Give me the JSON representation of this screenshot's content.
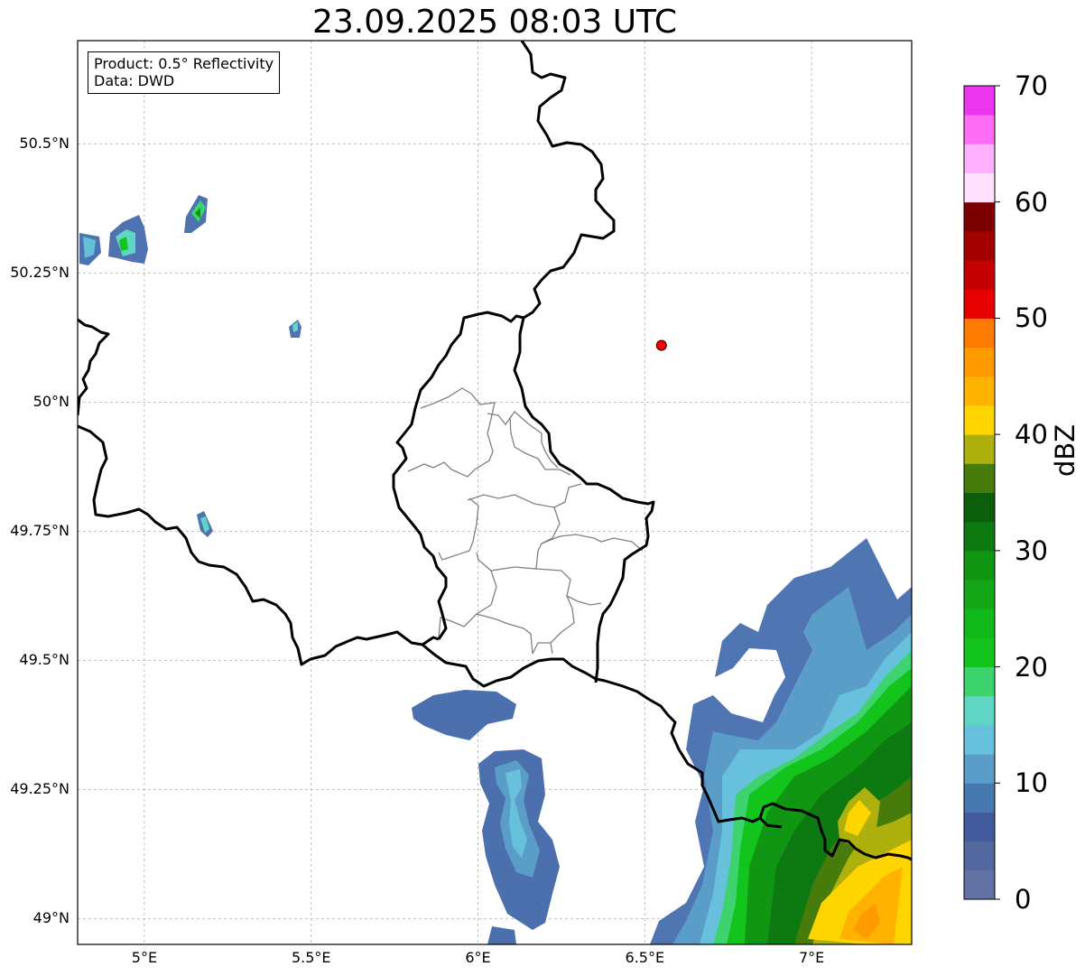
{
  "title": "23.09.2025 08:03 UTC",
  "info_box": {
    "line1": "Product: 0.5° Reflectivity",
    "line2": "Data: DWD"
  },
  "map": {
    "lon_ticks": [
      {
        "value": 5.0,
        "label": "5°E"
      },
      {
        "value": 5.5,
        "label": "5.5°E"
      },
      {
        "value": 6.0,
        "label": "6°E"
      },
      {
        "value": 6.5,
        "label": "6.5°E"
      },
      {
        "value": 7.0,
        "label": "7°E"
      }
    ],
    "lat_ticks": [
      {
        "value": 49.0,
        "label": "49°N"
      },
      {
        "value": 49.25,
        "label": "49.25°N"
      },
      {
        "value": 49.5,
        "label": "49.5°N"
      },
      {
        "value": 49.75,
        "label": "49.75°N"
      },
      {
        "value": 50.0,
        "label": "50°N"
      },
      {
        "value": 50.25,
        "label": "50.25°N"
      },
      {
        "value": 50.5,
        "label": "50.5°N"
      }
    ],
    "extent": {
      "lon_min": 4.8,
      "lon_max": 7.3,
      "lat_min": 48.95,
      "lat_max": 50.7
    },
    "marker": {
      "lon": 6.55,
      "lat": 50.11,
      "color": "#ff0000"
    },
    "gridlines": true
  },
  "colorbar": {
    "label": "dBZ",
    "ticks": [
      "0",
      "10",
      "20",
      "30",
      "40",
      "50",
      "60",
      "70"
    ],
    "min": 0,
    "max": 70,
    "step": 2.5,
    "colors": [
      "#6372a5",
      "#52689e",
      "#425b9e",
      "#4878b0",
      "#5a9dc8",
      "#67c1dc",
      "#5fd6c4",
      "#3dd470",
      "#12c41c",
      "#10b81a",
      "#13a617",
      "#119613",
      "#0c7a10",
      "#0a5e0c",
      "#477c0c",
      "#aeb00d",
      "#ffd500",
      "#ffb300",
      "#ff9b00",
      "#ff7a00",
      "#e60000",
      "#c40000",
      "#a30000",
      "#7c0000",
      "#ffe0ff",
      "#ffb0ff",
      "#ff6cf5",
      "#ec35ee"
    ]
  }
}
